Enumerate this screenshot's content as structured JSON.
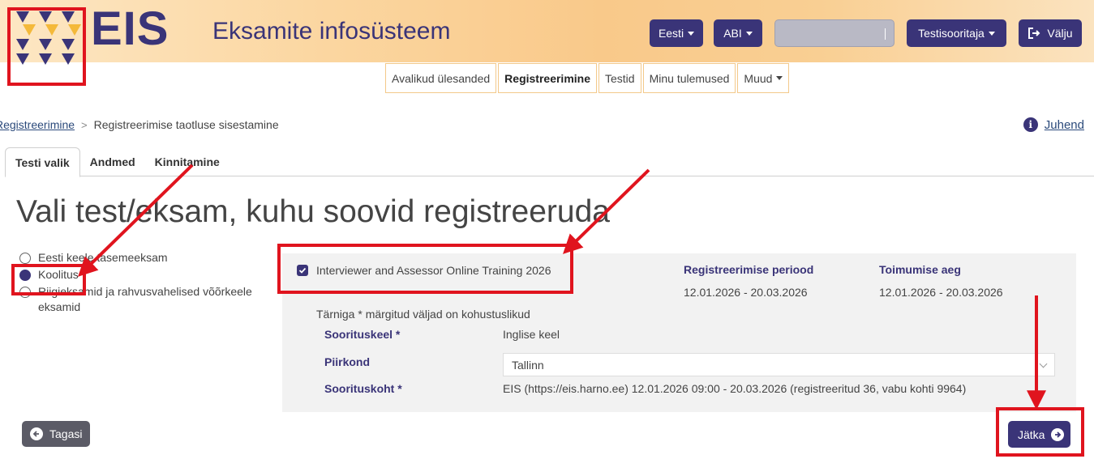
{
  "header": {
    "logo_text": "EIS",
    "app_title": "Eksamite infosüsteem",
    "language_label": "Eesti",
    "abi_label": "ABI",
    "role_label": "Testisooritaja",
    "logout_label": "Välju"
  },
  "nav": {
    "items": [
      {
        "label": "Avalikud ülesanded"
      },
      {
        "label": "Registreerimine"
      },
      {
        "label": "Testid"
      },
      {
        "label": "Minu tulemused"
      },
      {
        "label": "Muud"
      }
    ]
  },
  "breadcrumb": {
    "link": "Registreerimine",
    "current": "Registreerimise taotluse sisestamine"
  },
  "help": {
    "label": "Juhend",
    "icon": "info-icon"
  },
  "tabs": [
    {
      "label": "Testi valik"
    },
    {
      "label": "Andmed"
    },
    {
      "label": "Kinnitamine"
    }
  ],
  "page": {
    "heading": "Vali test/eksam, kuhu soovid registreeruda"
  },
  "exam_types": [
    {
      "label": "Eesti keele tasemeeksam",
      "selected": false
    },
    {
      "label": "Koolitus",
      "selected": true
    },
    {
      "label": "Riigieksamid ja rahvusvahelised võõrkeele eksamid",
      "selected": false
    }
  ],
  "test": {
    "name": "Interviewer and Assessor Online Training 2026",
    "checked": true,
    "reg_period_header": "Registreerimise periood",
    "reg_period_value": "12.01.2026 - 20.03.2026",
    "time_header": "Toimumise aeg",
    "time_value": "12.01.2026 - 20.03.2026"
  },
  "form": {
    "required_note": "Tärniga * märgitud väljad on kohustuslikud",
    "language_label": "Sooritus­keel *",
    "language_value": "Inglise keel",
    "region_label": "Piirkond",
    "region_value": "Tallinn",
    "place_label": "Soorituskoht *",
    "place_value": "EIS (https://eis.harno.ee) 12.01.2026 09:00 - 20.03.2026 (registreeritud 36, vabu kohti 9964)"
  },
  "buttons": {
    "back_label": "Tagasi",
    "next_label": "Jätka"
  },
  "colors": {
    "brand": "#3a3478",
    "annotation": "#e0141e"
  }
}
